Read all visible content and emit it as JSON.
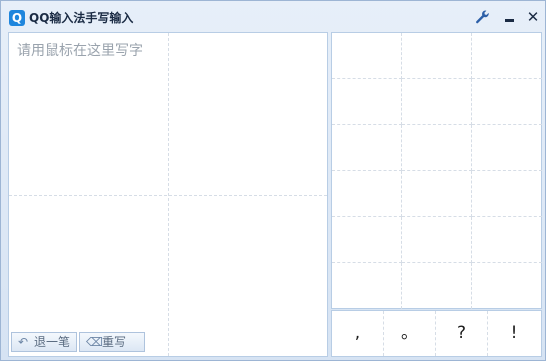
{
  "window": {
    "app_icon_letter": "Q",
    "title": "QQ输入法手写输入",
    "controls": {
      "settings_icon": "wrench-icon",
      "minimize_icon": "minimize-icon",
      "close_glyph": "✕"
    }
  },
  "write_area": {
    "placeholder": "请用鼠标在这里写字",
    "undo_label": "退一笔",
    "undo_icon": "↶",
    "clear_label": "重写",
    "clear_icon": "⌫"
  },
  "candidates": {
    "rows": 6,
    "cols": 3,
    "items": []
  },
  "punctuation": [
    ",",
    "。",
    "?",
    "!"
  ]
}
